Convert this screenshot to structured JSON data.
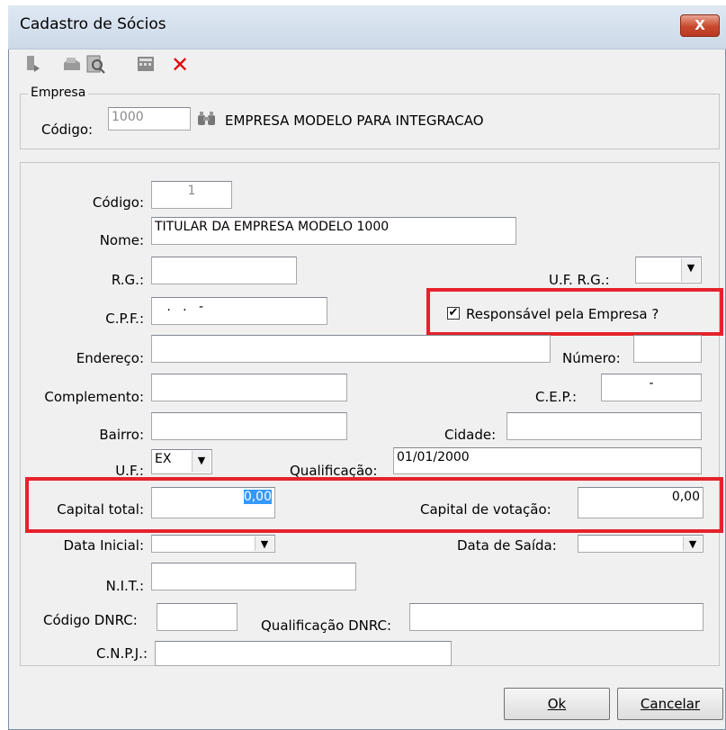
{
  "window": {
    "title": "Cadastro de Sócios",
    "close_glyph": "X"
  },
  "toolbar": {
    "icons": [
      "exit-icon",
      "print-icon",
      "preview-icon",
      "calculator-icon",
      "delete-x-icon"
    ]
  },
  "empresa": {
    "legend": "Empresa",
    "codigo_label": "Código:",
    "codigo_value": "1000",
    "nome": "EMPRESA MODELO PARA INTEGRACAO"
  },
  "form": {
    "codigo_label": "Código:",
    "codigo_value": "1",
    "nome_label": "Nome:",
    "nome_value": "TITULAR DA EMPRESA MODELO 1000",
    "rg_label": "R.G.:",
    "rg_value": "",
    "uf_rg_label": "U.F. R.G.:",
    "uf_rg_value": "",
    "cpf_label": "C.P.F.:",
    "cpf_value": "   .   .   -",
    "responsavel_label": "Responsável pela Empresa ?",
    "responsavel_checked": "✔",
    "endereco_label": "Endereço:",
    "endereco_value": "",
    "numero_label": "Número:",
    "numero_value": "",
    "complemento_label": "Complemento:",
    "complemento_value": "",
    "cep_label": "C.E.P.:",
    "cep_value": "-",
    "bairro_label": "Bairro:",
    "bairro_value": "",
    "cidade_label": "Cidade:",
    "cidade_value": "",
    "uf_label": "U.F.:",
    "uf_value": "EX",
    "qualificacao_label": "Qualificação:",
    "qualificacao_value": "01/01/2000",
    "capital_total_label": "Capital total:",
    "capital_total_value": "0,00",
    "capital_votacao_label": "Capital de votação:",
    "capital_votacao_value": "0,00",
    "data_inicial_label": "Data Inicial:",
    "data_inicial_value": "",
    "data_saida_label": "Data de Saída:",
    "data_saida_value": "",
    "nit_label": "N.I.T.:",
    "nit_value": "",
    "codigo_dnrc_label": "Código DNRC:",
    "codigo_dnrc_value": "",
    "qualificacao_dnrc_label": "Qualificação DNRC:",
    "qualificacao_dnrc_value": "",
    "cnpj_label": "C.N.P.J.:",
    "cnpj_value": ""
  },
  "buttons": {
    "ok_label": "Ok",
    "cancel_label": "Cancelar"
  },
  "colors": {
    "highlight": "#e5222b",
    "selection": "#3399ff"
  }
}
